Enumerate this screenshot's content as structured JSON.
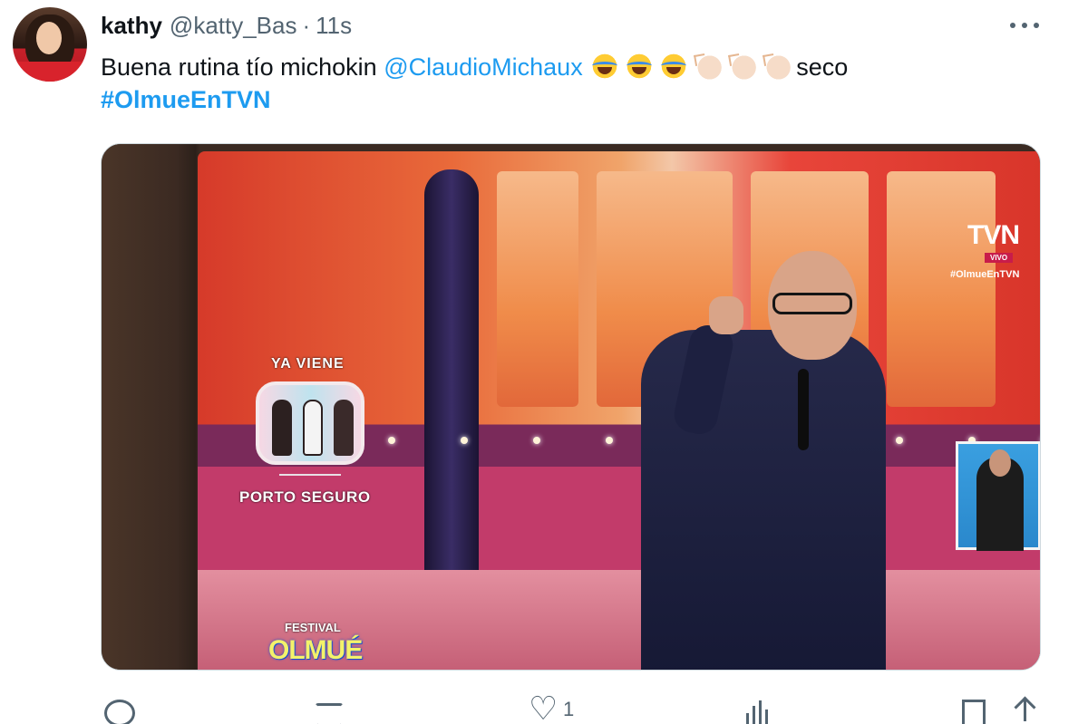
{
  "tweet": {
    "display_name": "kathy",
    "handle": "@katty_Bas",
    "separator": "·",
    "time": "11s",
    "text_before": "Buena rutina tío michokin ",
    "mention": "@ClaudioMichaux",
    "text_after": "seco",
    "hashtag": "#OlmueEnTVN",
    "emojis": [
      "laughing-face",
      "laughing-face",
      "laughing-face",
      "clapping-hands",
      "clapping-hands",
      "clapping-hands"
    ]
  },
  "media": {
    "overlay_ya_viene": "YA VIENE",
    "overlay_porto": "PORTO SEGURO",
    "channel_logo": "TVN",
    "channel_live": "VIVO",
    "channel_hashtag": "#OlmueEnTVN",
    "festival_line1": "FESTIVAL",
    "festival_line2": "OLMUÉ"
  },
  "actions": {
    "like_count": "1"
  },
  "icons": {
    "more": "more-icon",
    "reply": "reply-icon",
    "retweet": "retweet-icon",
    "like": "like-icon",
    "views": "views-icon",
    "bookmark": "bookmark-icon",
    "share": "share-icon"
  },
  "colors": {
    "link": "#1d9bf0",
    "text": "#0f1419",
    "secondary": "#536471"
  }
}
